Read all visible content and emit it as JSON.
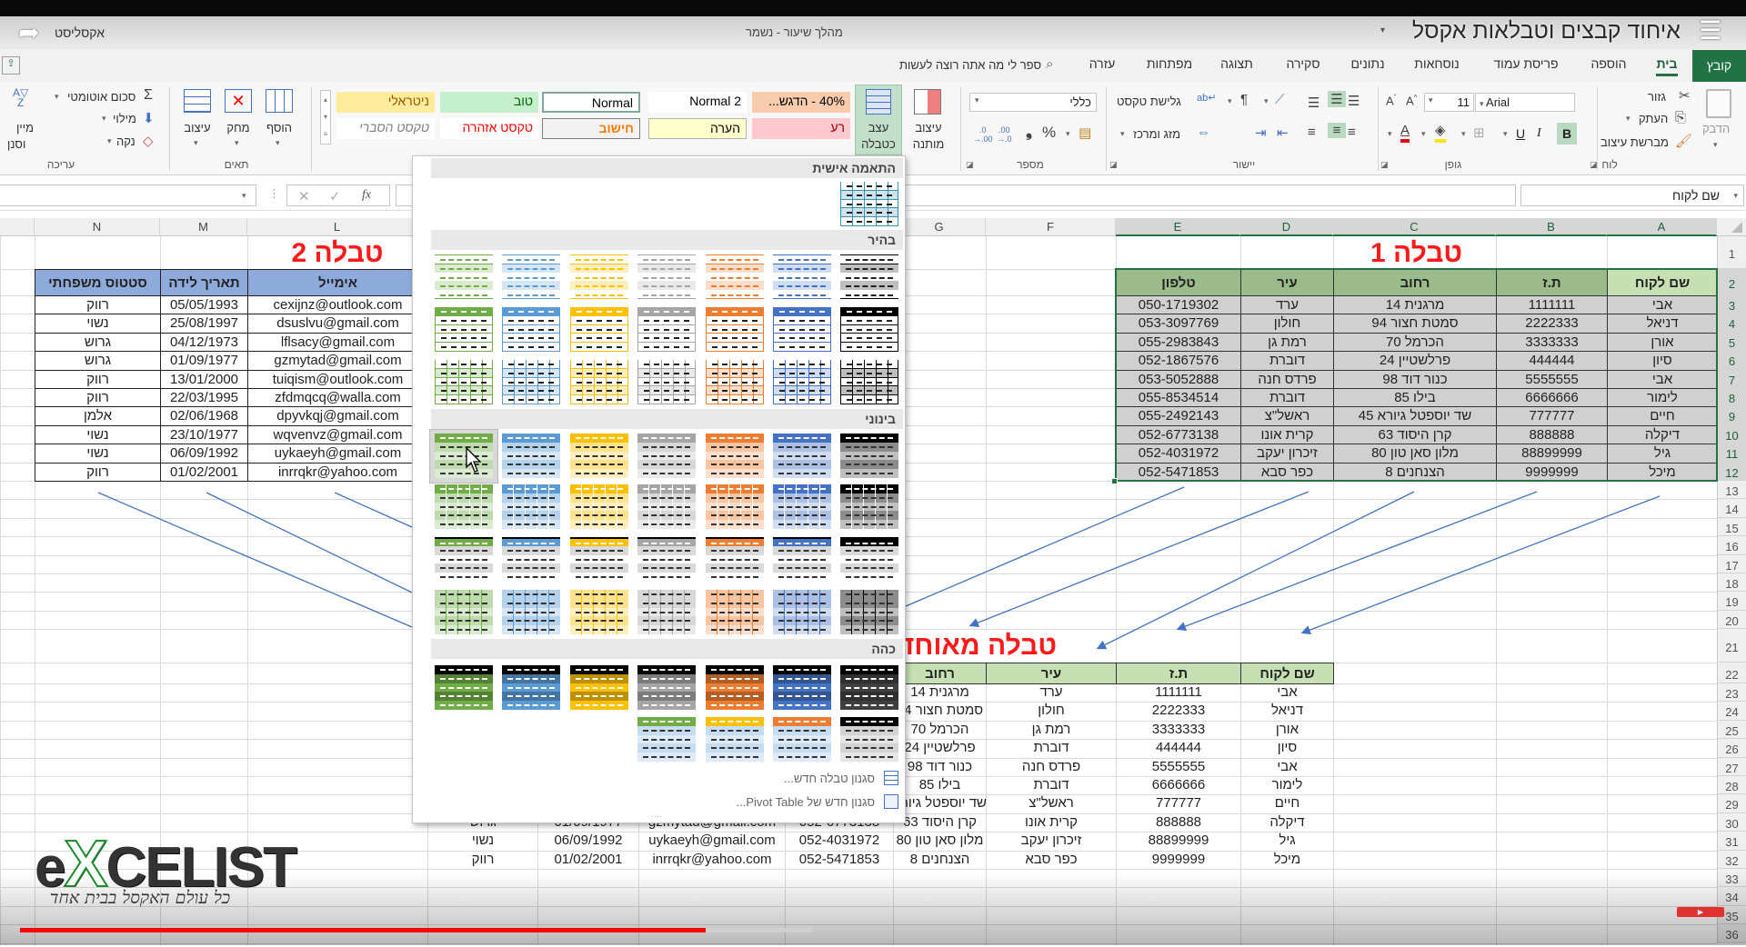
{
  "titlebar": {
    "app_name": "אקסליסט",
    "status": "מהלך שיעור  -  נשמר",
    "video_title": "איחוד קבצים וטבלאות אקסל"
  },
  "tabs": [
    "קובץ",
    "בית",
    "הוספה",
    "פריסת עמוד",
    "נוסחאות",
    "נתונים",
    "סקירה",
    "תצוגה",
    "מפתחות",
    "עזרה"
  ],
  "active_tab": "בית",
  "search_placeholder": "ספר לי מה אתה רוצה לעשות",
  "ribbon": {
    "clipboard": {
      "label": "לוח",
      "paste": "הדבק",
      "cut": "גזור",
      "copy": "העתק",
      "format_painter": "מברשת עיצוב"
    },
    "font": {
      "label": "גופן",
      "font_name": "Arial",
      "font_size": "11",
      "bold": "B",
      "italic": "I",
      "underline": "U"
    },
    "alignment": {
      "label": "יישור",
      "wrap_text": "גלישת טקסט",
      "merge_center": "מזג ומרכז"
    },
    "number": {
      "label": "מספר",
      "format": "כללי"
    },
    "styles": {
      "conditional_1": "עיצוב",
      "conditional_2": "מותנה",
      "format_table_1": "עצב",
      "format_table_2": "כטבלה",
      "cell_styles_row1": [
        {
          "label": "ניטראלי",
          "bg": "#ffeb9c",
          "fg": "#9c5700"
        },
        {
          "label": "טוב",
          "bg": "#c6efce",
          "fg": "#006100"
        },
        {
          "label": "Normal",
          "bg": "#ffffff",
          "fg": "#000000"
        },
        {
          "label": "Normal 2",
          "bg": "#ffffff",
          "fg": "#000000"
        },
        {
          "label": "40% - הדגש...",
          "bg": "#f8cbad",
          "fg": "#000000"
        }
      ],
      "cell_styles_row2": [
        {
          "label": "טקסט הסברי",
          "bg": "#ffffff",
          "fg": "#7f7f7f"
        },
        {
          "label": "טקסט אזהרה",
          "bg": "#ffffff",
          "fg": "#ff0000"
        },
        {
          "label": "חישוב",
          "bg": "#f2f2f2",
          "fg": "#fa7d00"
        },
        {
          "label": "הערה",
          "bg": "#ffffcc",
          "fg": "#000000"
        },
        {
          "label": "רע",
          "bg": "#ffc7ce",
          "fg": "#9c0006"
        }
      ]
    },
    "cells": {
      "label": "תאים",
      "insert": "הוסף",
      "delete": "מחק",
      "format": "עיצוב"
    },
    "editing": {
      "label": "עריכה",
      "autosum": "סכום אוטומטי",
      "fill": "מילוי",
      "clear": "נקה",
      "sort_1": "מיין",
      "sort_2": "וסנן"
    }
  },
  "formula_bar": {
    "name_box": "שם לקוח",
    "formula": "",
    "fx": "fx"
  },
  "columns": {
    "A": "A",
    "B": "B",
    "C": "C",
    "D": "D",
    "E": "E",
    "F": "F",
    "G": "G",
    "L": "L",
    "M": "M",
    "N": "N"
  },
  "row_numbers": [
    "1",
    "2",
    "3",
    "4",
    "5",
    "6",
    "7",
    "8",
    "9",
    "10",
    "11",
    "12",
    "13",
    "14",
    "15",
    "16",
    "17",
    "18",
    "19",
    "20",
    "21",
    "22",
    "23",
    "24",
    "25",
    "26",
    "27",
    "28",
    "29",
    "30",
    "31",
    "32",
    "33",
    "34",
    "35",
    "36"
  ],
  "table1": {
    "title": "טבלה 1",
    "headers": [
      "שם לקוח",
      "ת.ז",
      "רחוב",
      "עיר",
      "טלפון"
    ],
    "rows": [
      [
        "אבי",
        "1111111",
        "מרגנית 14",
        "ערד",
        "050-1719302"
      ],
      [
        "דניאל",
        "2222333",
        "סמטת חצור 94",
        "חולון",
        "053-3097769"
      ],
      [
        "אורן",
        "3333333",
        "הכרמל 70",
        "רמת גן",
        "055-2983843"
      ],
      [
        "סיון",
        "444444",
        "פרלשטיין 24",
        "דוברת",
        "052-1867576"
      ],
      [
        "אבי",
        "5555555",
        "כנור דוד 98",
        "פרדס חנה",
        "053-5052888"
      ],
      [
        "לימור",
        "6666666",
        "בילו 85",
        "דוברת",
        "055-8534514"
      ],
      [
        "חיים",
        "777777",
        "שד יוספטל גיורא 45",
        "ראשל\"צ",
        "055-2492143"
      ],
      [
        "דיקלה",
        "888888",
        "קרן היסוד 63",
        "קרית אונו",
        "052-6773138"
      ],
      [
        "גיל",
        "88899999",
        "מלון סאן טון 80",
        "זיכרון יעקב",
        "052-4031972"
      ],
      [
        "מיכל",
        "9999999",
        "הצנחנים 8",
        "כפר סבא",
        "052-5471853"
      ]
    ]
  },
  "table2": {
    "title": "טבלה 2",
    "headers": [
      "אימייל",
      "תאריך לידה",
      "סטטוס משפחתי"
    ],
    "rows": [
      [
        "cexijnz@outlook.com",
        "05/05/1993",
        "רווק"
      ],
      [
        "dsuslvu@gmail.com",
        "25/08/1997",
        "נשוי"
      ],
      [
        "lflsacy@gmail.com",
        "04/12/1973",
        "גרוש"
      ],
      [
        "gzmytad@gmail.com",
        "01/09/1977",
        "גרוש"
      ],
      [
        "tuiqism@outlook.com",
        "13/01/2000",
        "רווק"
      ],
      [
        "zfdmqcq@walla.com",
        "22/03/1995",
        "רווק"
      ],
      [
        "dpyvkqj@gmail.com",
        "02/06/1968",
        "אלמן"
      ],
      [
        "wqvenvz@gmail.com",
        "23/10/1977",
        "נשוי"
      ],
      [
        "uykaeyh@gmail.com",
        "06/09/1992",
        "נשוי"
      ],
      [
        "inrrqkr@yahoo.com",
        "01/02/2001",
        "רווק"
      ]
    ]
  },
  "merged": {
    "title": "טבלה מאוחד",
    "headers": [
      "שם לקוח",
      "ת.ז",
      "עיר",
      "רחוב"
    ],
    "rows": [
      [
        "אבי",
        "1111111",
        "ערד",
        "מרגנית 14"
      ],
      [
        "דניאל",
        "2222333",
        "חולון",
        "סמטת חצור 94"
      ],
      [
        "אורן",
        "3333333",
        "רמת גן",
        "הכרמל 70"
      ],
      [
        "סיון",
        "444444",
        "דוברת",
        "פרלשטיין 24"
      ],
      [
        "אבי",
        "5555555",
        "פרדס חנה",
        "כנור דוד 98"
      ],
      [
        "לימור",
        "6666666",
        "דוברת",
        "בילו 85"
      ],
      [
        "חיים",
        "777777",
        "ראשל\"צ",
        "שד יוספטל גיורא 45"
      ],
      [
        "דיקלה",
        "888888",
        "קרית אונו",
        "קרן היסוד 63"
      ],
      [
        "גיל",
        "88899999",
        "זיכרון יעקב",
        "מלון סאן טון 80"
      ],
      [
        "מיכל",
        "9999999",
        "כפר סבא",
        "הצנחנים 8"
      ]
    ],
    "extra_rows": [
      [
        "052-6773138",
        "gzmytad@gmail.com",
        "01/09/1977",
        "גרוש"
      ],
      [
        "052-4031972",
        "uykaeyh@gmail.com",
        "06/09/1992",
        "נשוי"
      ],
      [
        "052-5471853",
        "inrrqkr@yahoo.com",
        "01/02/2001",
        "רווק"
      ]
    ]
  },
  "table_styles_gallery": {
    "sections": {
      "custom": "התאמה אישית",
      "light": "בהיר",
      "medium": "בינוני",
      "dark": "כהה"
    },
    "colors": [
      "#70ad47",
      "#5b9bd5",
      "#ffc000",
      "#a5a5a5",
      "#ed7d31",
      "#4472c4",
      "#000000"
    ],
    "new_table_style": "סגנון טבלה חדש...",
    "new_pivot_style": "סגנון חדש של Pivot Table..."
  },
  "logo": {
    "part1": "e",
    "part2": "X",
    "part3": "CELIST",
    "tagline": "כל עולם האקסל בבית אחד"
  },
  "video_progress": 0.41,
  "colors": {
    "excel_green": "#217346",
    "title_red": "#ff1a1a",
    "arrow_blue": "#4472c4",
    "progress_red": "#ff0000"
  }
}
